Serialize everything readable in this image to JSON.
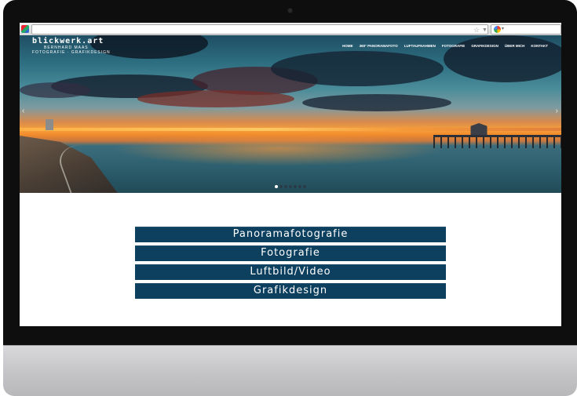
{
  "site": {
    "logo_title": "blickwerk.art",
    "logo_subtitle_1": "BERNHARD MAAS",
    "logo_subtitle_2": "FOTOGRAFIE · GRAFIKDESIGN"
  },
  "nav": {
    "items": [
      {
        "label": "Home"
      },
      {
        "label": "360° Panoramafoto"
      },
      {
        "label": "Luftaufnahmen"
      },
      {
        "label": "Fotografie"
      },
      {
        "label": "Grafikdesign"
      },
      {
        "label": "Über mich"
      },
      {
        "label": "Kontakt"
      }
    ]
  },
  "browser": {
    "icons": [
      "star-icon",
      "dropdown-icon",
      "reload-icon",
      "google-icon"
    ]
  },
  "slider": {
    "icons": [
      "chevron-left-icon",
      "chevron-right-icon"
    ],
    "arrow_left": "‹",
    "arrow_right": "›",
    "dot_count": 7,
    "active_dot": 1
  },
  "menu": {
    "buttons": [
      {
        "label": "Panoramafotografie"
      },
      {
        "label": "Fotografie"
      },
      {
        "label": "Luftbild/Video"
      },
      {
        "label": "Grafikdesign"
      }
    ]
  },
  "colors": {
    "button_bg": "#0d3f5f",
    "bezel": "#0e0e0f",
    "chin": "#c3c3c6"
  }
}
